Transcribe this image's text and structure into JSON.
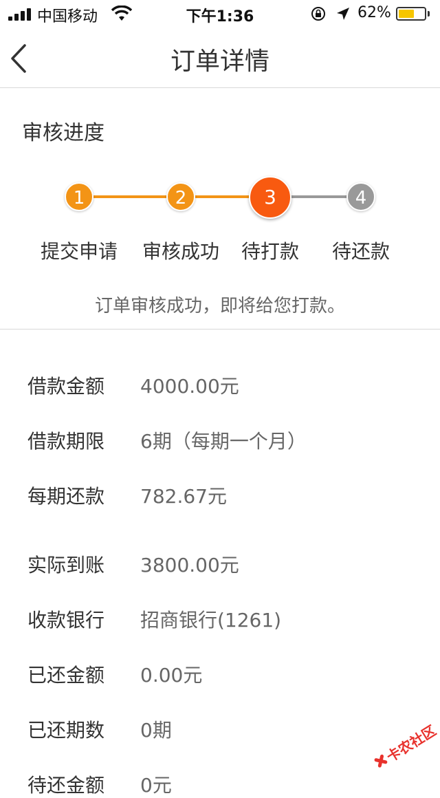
{
  "status_bar": {
    "carrier": "中国移动",
    "time": "下午1:36",
    "battery_percent": "62%",
    "battery_level": 0.62,
    "battery_color": "#f7c600"
  },
  "nav": {
    "title": "订单详情",
    "back_icon": "chevron-left-icon"
  },
  "progress": {
    "title": "审核进度",
    "current_step": 3,
    "steps": [
      {
        "number": "1",
        "label": "提交申请",
        "state": "done"
      },
      {
        "number": "2",
        "label": "审核成功",
        "state": "done"
      },
      {
        "number": "3",
        "label": "待打款",
        "state": "current"
      },
      {
        "number": "4",
        "label": "待还款",
        "state": "pending"
      }
    ],
    "message": "订单审核成功，即将给您打款。",
    "colors": {
      "done": "#f39416",
      "current": "#f85a10",
      "pending": "#999999"
    }
  },
  "details": [
    {
      "label": "借款金额",
      "value": "4000.00元"
    },
    {
      "label": "借款期限",
      "value": "6期（每期一个月）"
    },
    {
      "label": "每期还款",
      "value": "782.67元"
    },
    {
      "label": "实际到账",
      "value": "3800.00元"
    },
    {
      "label": "收款银行",
      "value": "招商银行(1261)"
    },
    {
      "label": "已还金额",
      "value": "0.00元"
    },
    {
      "label": "已还期数",
      "value": "0期"
    },
    {
      "label": "待还金额",
      "value": "0元"
    }
  ],
  "watermark": {
    "text": "卡农社区",
    "color": "#e8322d"
  }
}
